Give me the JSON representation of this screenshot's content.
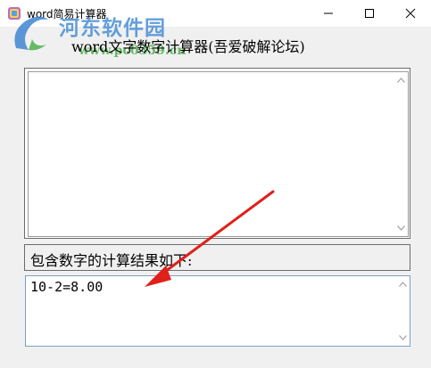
{
  "window": {
    "title": "word简易计算器",
    "minimize_glyph": "—",
    "maximize_glyph": "☐",
    "close_glyph": "✕"
  },
  "watermark": {
    "site_name": "河东软件园",
    "url": "www.pc0359.cn"
  },
  "app": {
    "heading": "word文字数字计算器(吾爱破解论坛)",
    "input_text": "",
    "result_label": "包含数字的计算结果如下:",
    "result_value": "10-2=8.00"
  },
  "colors": {
    "arrow": "#e0201a",
    "watermark_blue": "#4a8fd6",
    "watermark_green": "#4fb04f"
  }
}
